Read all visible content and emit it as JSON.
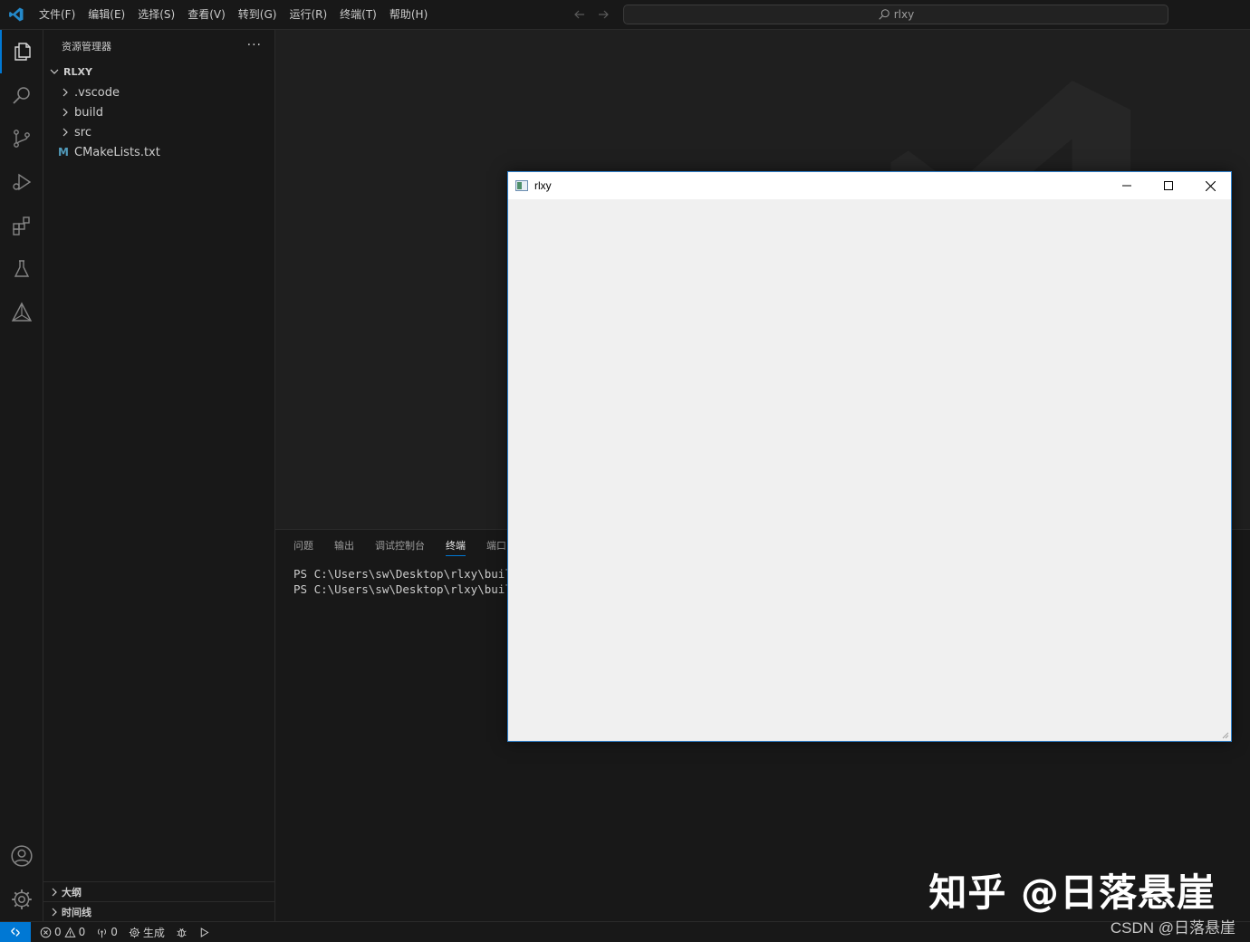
{
  "titlebar": {
    "menu": [
      "文件(F)",
      "编辑(E)",
      "选择(S)",
      "查看(V)",
      "转到(G)",
      "运行(R)",
      "终端(T)",
      "帮助(H)"
    ],
    "search_text": "rlxy"
  },
  "activitybar": {
    "items": [
      "explorer-icon",
      "search-icon",
      "source-control-icon",
      "run-debug-icon",
      "extensions-icon",
      "testing-icon",
      "cmake-icon"
    ],
    "bottom": [
      "account-icon",
      "settings-gear-icon"
    ],
    "accent": "#0078d4"
  },
  "sidebar": {
    "title": "资源管理器",
    "more": "···",
    "root": "RLXY",
    "items": [
      {
        "label": ".vscode",
        "type": "folder"
      },
      {
        "label": "build",
        "type": "folder"
      },
      {
        "label": "src",
        "type": "folder"
      },
      {
        "label": "CMakeLists.txt",
        "type": "file",
        "badge": "M"
      }
    ],
    "sections": [
      "大纲",
      "时间线"
    ]
  },
  "panel": {
    "tabs": [
      "问题",
      "输出",
      "调试控制台",
      "终端",
      "端口"
    ],
    "active_tab": "终端",
    "terminal_lines": [
      "PS C:\\Users\\sw\\Desktop\\rlxy\\build>",
      "PS C:\\Users\\sw\\Desktop\\rlxy\\build>"
    ]
  },
  "statusbar": {
    "errors": "0",
    "warnings": "0",
    "ports": "0",
    "build_label": "生成"
  },
  "app_window": {
    "title": "rlxy"
  },
  "watermark": {
    "zhihu": "知乎 @日落悬崖",
    "csdn": "CSDN @日落悬崖"
  }
}
